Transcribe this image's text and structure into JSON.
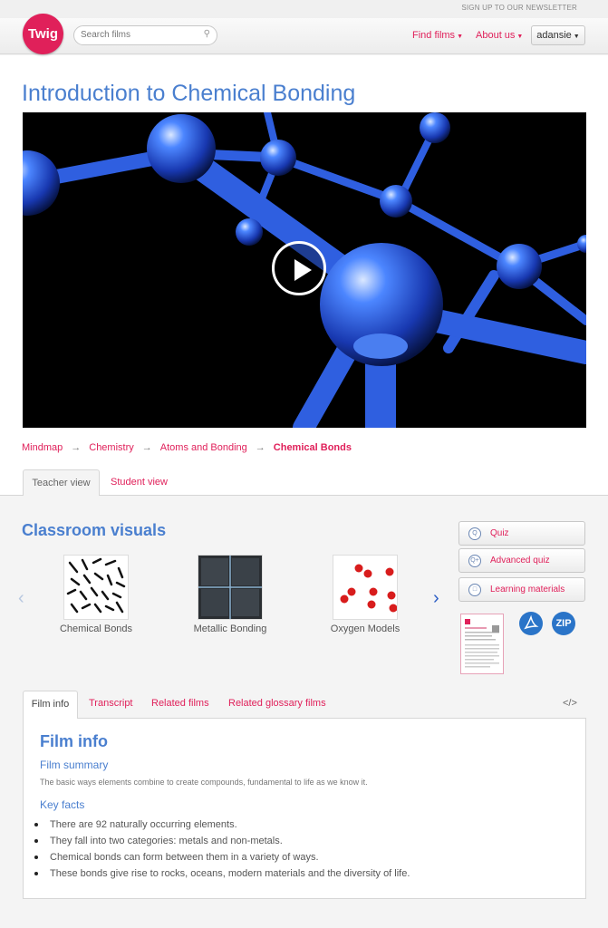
{
  "header": {
    "newsletter": "SIGN UP TO OUR NEWSLETTER",
    "logo_text": "Twig",
    "search_placeholder": "Search films",
    "nav_find": "Find films",
    "nav_about": "About us",
    "user": "adansie",
    "brand_color": "#e0205a"
  },
  "page": {
    "title": "Introduction to Chemical Bonding",
    "title_color": "#4a7fcf"
  },
  "breadcrumb": [
    "Mindmap",
    "Chemistry",
    "Atoms and Bonding",
    "Chemical Bonds"
  ],
  "view_tabs": {
    "teacher": "Teacher view",
    "student": "Student view"
  },
  "visuals": {
    "title": "Classroom visuals",
    "items": [
      "Chemical Bonds",
      "Metallic Bonding",
      "Oxygen Models"
    ]
  },
  "resources": {
    "quiz": "Quiz",
    "advanced_quiz": "Advanced quiz",
    "learning_materials": "Learning materials",
    "pdf_icon": "pdf-icon",
    "zip_label": "ZIP"
  },
  "info_tabs": [
    "Film info",
    "Transcript",
    "Related films",
    "Related glossary films"
  ],
  "embed_label": "</>",
  "film_info": {
    "title": "Film info",
    "summary_heading": "Film summary",
    "summary": "The basic ways elements combine to create compounds, fundamental to life as we know it.",
    "facts_heading": "Key facts",
    "facts": [
      "There are 92 naturally occurring elements.",
      "They fall into two categories: metals and non-metals.",
      "Chemical bonds can form between them in a variety of ways.",
      "These bonds give rise to rocks, oceans, modern materials and the diversity of life."
    ]
  }
}
